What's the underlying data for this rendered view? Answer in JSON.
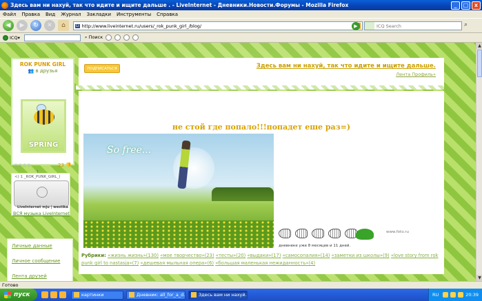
{
  "window": {
    "title": "Здесь вам ни нахуй, так что идите и ищите дальше . - LiveInternet - Дневники.Новости.Форумы - Mozilla Firefox",
    "minimize": "_",
    "maximize": "□",
    "close": "x"
  },
  "menu": [
    "Файл",
    "Правка",
    "Вид",
    "Журнал",
    "Закладки",
    "Инструменты",
    "Справка"
  ],
  "nav": {
    "url": "http://www.liveinternet.ru/users/_rok_punk_girl_/blog/",
    "site_icon_text": "Li",
    "search_placeholder": "ICQ Search",
    "search_engine_icon": "icq-flower-icon"
  },
  "toolbar2": {
    "icq_label": "ICQ",
    "search_label": "Поиск"
  },
  "profile": {
    "name": "ROK PUNK GIRL",
    "friends_link": "в друзья",
    "avatar_text": "SPRING",
    "stars": "☆☆☆☆",
    "rating_value": "1",
    "rank_value": "23"
  },
  "music": {
    "widget_title": "<) 1 _ROK_PUNK_GIRL_)",
    "brand": "LiveInternet  mju | westika",
    "all_music_link": "ВСЯ музыка LiveInternet"
  },
  "sidebar_links": [
    "Личные данные",
    "Личное сообщение",
    "Лента друзей"
  ],
  "header": {
    "subscribe_button": "ПОДПИСАТЬСЯ",
    "slogan": "Здесь вам ни нахуй, так что идите и ищите дальше.",
    "feed_link": "Лента Профиль»"
  },
  "post": {
    "title": "не стой где попало!!!попадет еше раз=)",
    "image_caption": "So free...",
    "days_ago": "дневнеке уже 8 месяцев и 11 дней.",
    "watermark": "www.foto.ru",
    "rubrics_label": "Рубрики:",
    "rubrics": [
      "«жизнь жизнь»(130)",
      "«мое творчество»(23)",
      "«тесты»(20)",
      "«выдаки»(17)",
      "«самосопалия»(14)",
      "«заметки из школы»(9)",
      "«love story from rok punk girl to nastasja»(7)",
      "«дешевая мыльная опера»(6)",
      "«большая маленькая нежиданность»(4)"
    ]
  },
  "status_text": "Готово",
  "taskbar": {
    "start": "пуск",
    "tasks": [
      {
        "label": "картинки",
        "active": false
      },
      {
        "label": "Дневник: all_for_a_d...",
        "active": false
      },
      {
        "label": "Здесь вам ни нахуй...",
        "active": true
      }
    ],
    "lang": "RU",
    "clock": "20:39"
  },
  "colors": {
    "accent_green": "#9fcf4d",
    "title_gold": "#d8a200",
    "link_green": "#86ad43"
  }
}
